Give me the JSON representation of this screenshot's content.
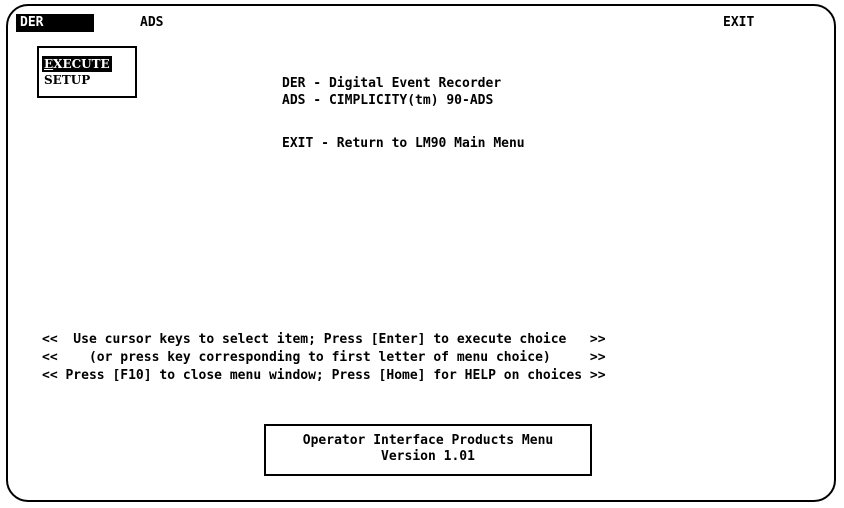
{
  "menubar": {
    "items": [
      {
        "label": "DER",
        "active": true
      },
      {
        "label": "ADS",
        "active": false
      },
      {
        "label": "EXIT",
        "active": false
      }
    ]
  },
  "dropdown": {
    "items": [
      {
        "hotkey": "E",
        "rest": "XECUTE",
        "selected": true
      },
      {
        "label": "SETUP",
        "selected": false
      }
    ]
  },
  "descriptions": [
    "DER - Digital Event Recorder",
    "ADS - CIMPLICITY(tm) 90-ADS",
    "EXIT - Return to LM90 Main Menu"
  ],
  "help_lines": [
    "<<  Use cursor keys to select item; Press [Enter] to execute choice   >>",
    "<<    (or press key corresponding to first letter of menu choice)     >>",
    "<< Press [F10] to close menu window; Press [Home] for HELP on choices >>"
  ],
  "info_box": {
    "title": "Operator Interface Products Menu",
    "version": "Version 1.01"
  },
  "colors": {
    "foreground": "#000000",
    "background": "#ffffff",
    "highlight": "#000000"
  }
}
